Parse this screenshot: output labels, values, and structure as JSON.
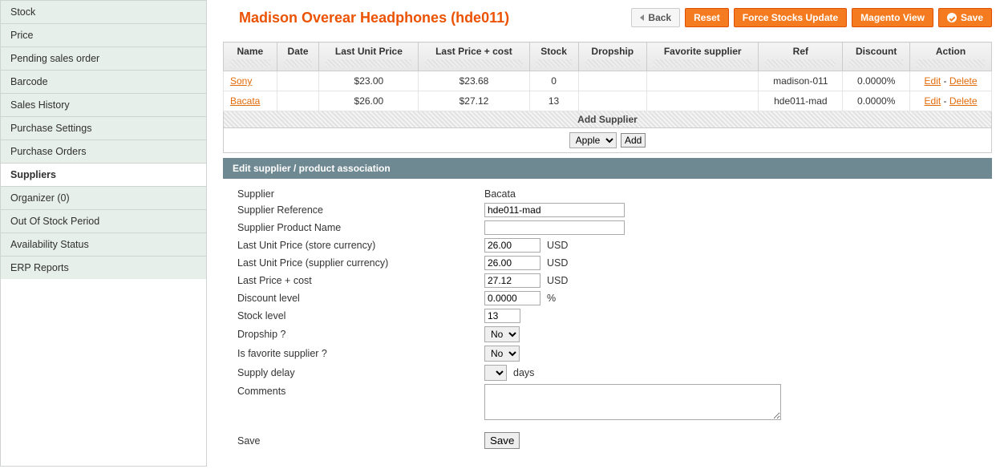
{
  "sidebar": {
    "items": [
      {
        "label": "Stock"
      },
      {
        "label": "Price"
      },
      {
        "label": "Pending sales order"
      },
      {
        "label": "Barcode"
      },
      {
        "label": "Sales History"
      },
      {
        "label": "Purchase Settings"
      },
      {
        "label": "Purchase Orders"
      },
      {
        "label": "Suppliers"
      },
      {
        "label": "Organizer (0)"
      },
      {
        "label": "Out Of Stock Period"
      },
      {
        "label": "Availability Status"
      },
      {
        "label": "ERP Reports"
      }
    ],
    "active_index": 7
  },
  "header": {
    "title": "Madison Overear Headphones (hde011)",
    "buttons": {
      "back": "Back",
      "reset": "Reset",
      "force_stocks": "Force Stocks Update",
      "magento_view": "Magento View",
      "save": "Save"
    }
  },
  "table": {
    "columns": [
      "Name",
      "Date",
      "Last Unit Price",
      "Last Price + cost",
      "Stock",
      "Dropship",
      "Favorite supplier",
      "Ref",
      "Discount",
      "Action"
    ],
    "rows": [
      {
        "name": "Sony",
        "date": "",
        "last_unit_price": "$23.00",
        "last_price_cost": "$23.68",
        "stock": "0",
        "dropship": "",
        "favorite": "",
        "ref": "madison-011",
        "discount": "0.0000%"
      },
      {
        "name": "Bacata",
        "date": "",
        "last_unit_price": "$26.00",
        "last_price_cost": "$27.12",
        "stock": "13",
        "dropship": "",
        "favorite": "",
        "ref": "hde011-mad",
        "discount": "0.0000%"
      }
    ],
    "action_edit": "Edit",
    "action_delete": "Delete"
  },
  "add_supplier": {
    "title": "Add Supplier",
    "selected": "Apple",
    "button": "Add"
  },
  "panel": {
    "title": "Edit supplier / product association"
  },
  "form": {
    "supplier_label": "Supplier",
    "supplier_value": "Bacata",
    "reference_label": "Supplier Reference",
    "reference_value": "hde011-mad",
    "product_name_label": "Supplier Product Name",
    "product_name_value": "",
    "last_unit_store_label": "Last Unit Price (store currency)",
    "last_unit_store_value": "26.00",
    "last_unit_supplier_label": "Last Unit Price (supplier currency)",
    "last_unit_supplier_value": "26.00",
    "last_price_cost_label": "Last Price + cost",
    "last_price_cost_value": "27.12",
    "discount_label": "Discount level",
    "discount_value": "0.0000",
    "stock_label": "Stock level",
    "stock_value": "13",
    "dropship_label": "Dropship ?",
    "dropship_value": "No",
    "favorite_label": "Is favorite supplier ?",
    "favorite_value": "No",
    "delay_label": "Supply delay",
    "delay_unit": "days",
    "comments_label": "Comments",
    "comments_value": "",
    "currency": "USD",
    "percent": "%",
    "save_label": "Save",
    "save_button": "Save"
  }
}
